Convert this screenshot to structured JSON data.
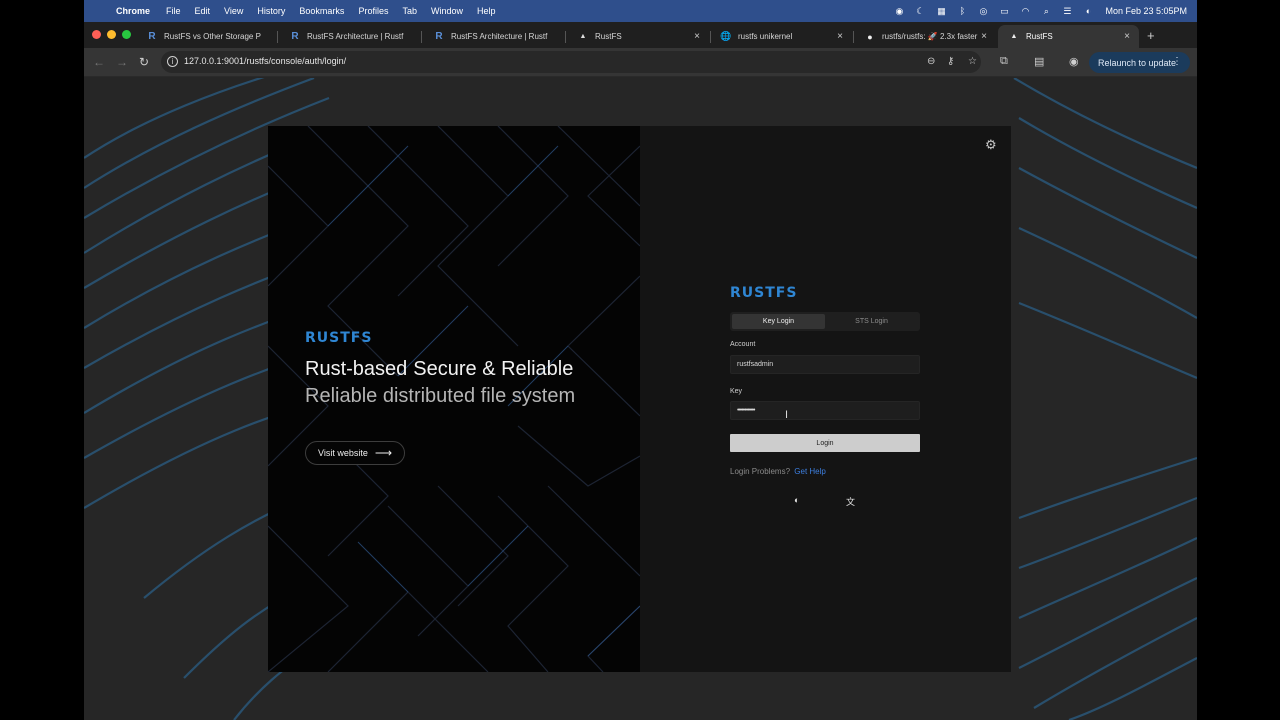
{
  "menubar": {
    "app": "Chrome",
    "items": [
      "File",
      "Edit",
      "View",
      "History",
      "Bookmarks",
      "Profiles",
      "Tab",
      "Window",
      "Help"
    ],
    "clock": "Mon Feb 23  5:05PM"
  },
  "tabs": [
    {
      "title": "RustFS vs Other Storage P",
      "favicon": "R"
    },
    {
      "title": "RustFS Architecture | Rustf",
      "favicon": "R"
    },
    {
      "title": "RustFS Architecture | Rustf",
      "favicon": "R"
    },
    {
      "title": "RustFS",
      "favicon": "▲"
    },
    {
      "title": "rustfs unikernel",
      "favicon": "🌐"
    },
    {
      "title": "rustfs/rustfs: 🚀 2.3x faster",
      "favicon": "●"
    },
    {
      "title": "RustFS",
      "favicon": "▲"
    }
  ],
  "toolbar": {
    "url": "127.0.0.1:9001/rustfs/console/auth/login/",
    "relaunch": "Relaunch to update"
  },
  "hero": {
    "logo": "RUSTFS",
    "line1a": "Rust-based",
    "line1b": "Secure & Reliable",
    "line2": "Reliable distributed file system",
    "visit": "Visit website"
  },
  "login": {
    "logo": "RUSTFS",
    "tab_key": "Key Login",
    "tab_sts": "STS Login",
    "account_label": "Account",
    "account_value": "rustfsadmin",
    "key_label": "Key",
    "key_value": "••••••••••••",
    "button": "Login",
    "problems": "Login Problems?",
    "help": "Get Help"
  },
  "colors": {
    "brand": "#2f86d3",
    "link": "#3d7fe0",
    "menubar": "#2f4f8c"
  }
}
